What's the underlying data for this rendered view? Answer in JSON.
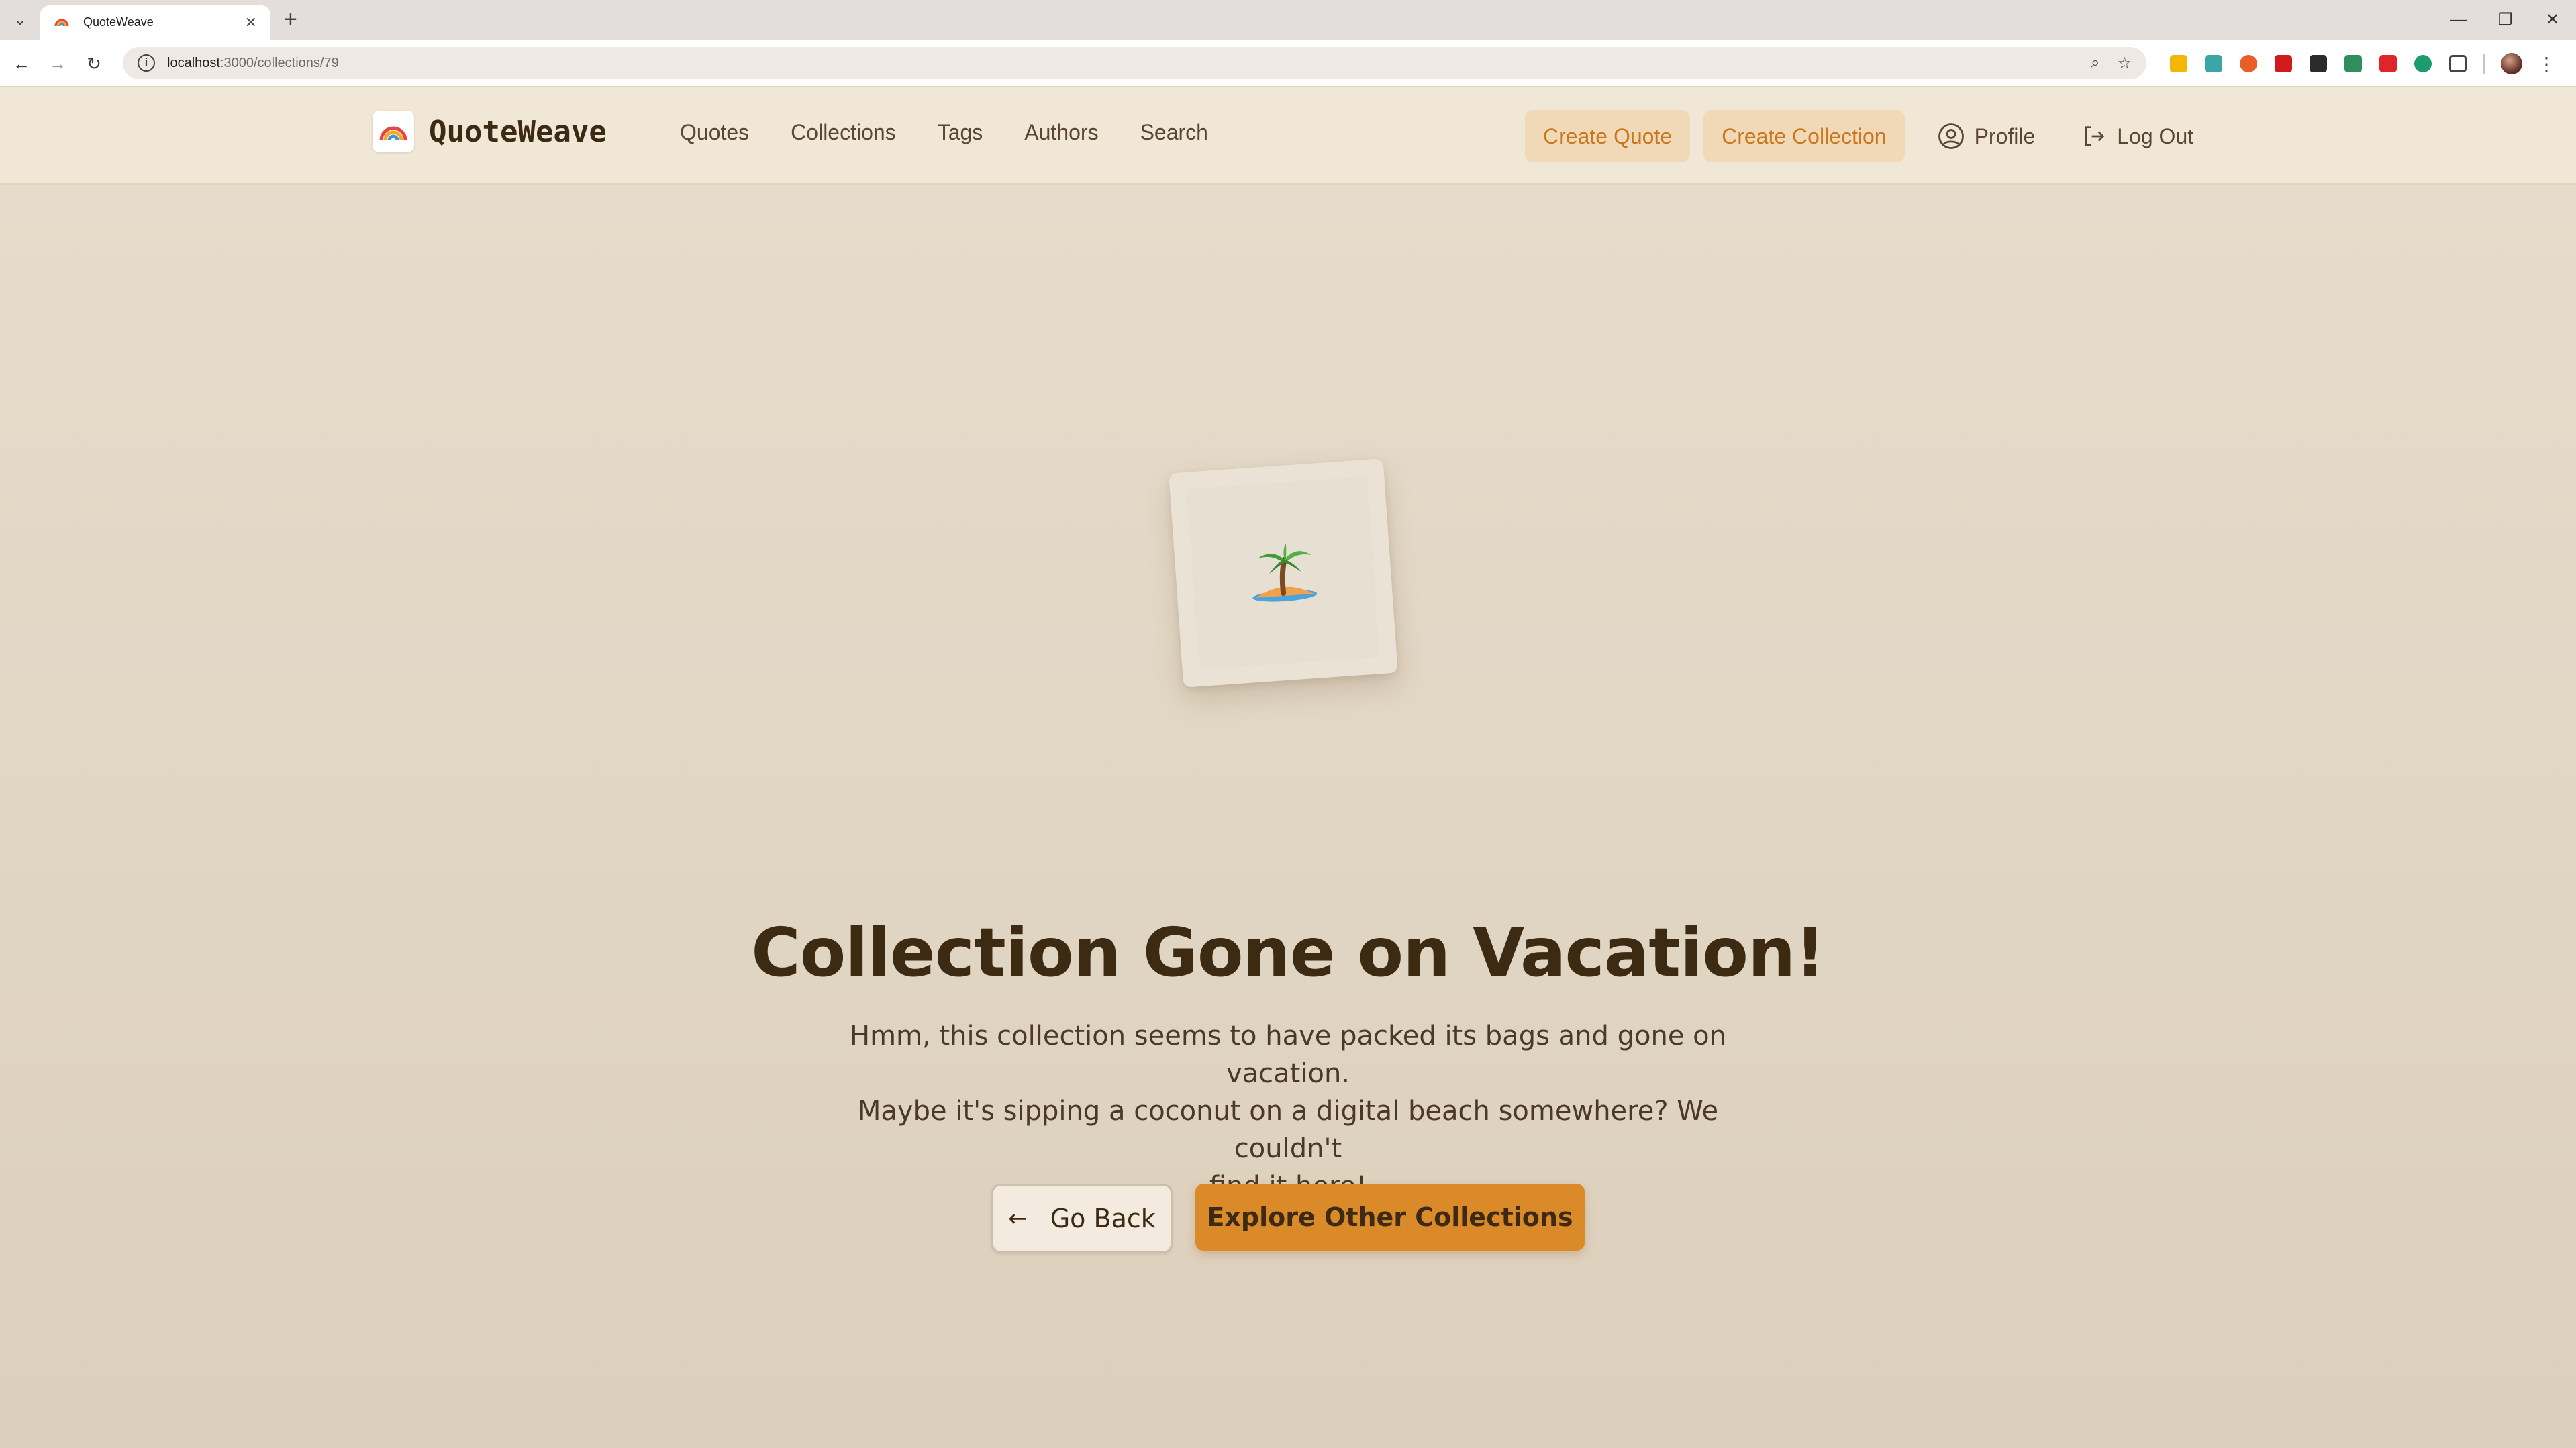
{
  "browser": {
    "tab_title": "QuoteWeave",
    "url_host": "localhost",
    "url_path": ":3000/collections/79"
  },
  "header": {
    "brand": "QuoteWeave",
    "nav": [
      "Quotes",
      "Collections",
      "Tags",
      "Authors",
      "Search"
    ],
    "create_quote": "Create Quote",
    "create_collection": "Create Collection",
    "profile": "Profile",
    "logout": "Log Out"
  },
  "main": {
    "illustration": "palm-tree-island-icon",
    "title": "Collection Gone on Vacation!",
    "message_lines": [
      "Hmm, this collection seems to have packed its bags and gone on vacation.",
      "Maybe it's sipping a coconut on a digital beach somewhere? We couldn't",
      "find it here!"
    ],
    "back_button": "Go Back",
    "explore_button": "Explore Other Collections"
  },
  "colors": {
    "accent": "#db8a2a",
    "header_bg": "#f1e7d6",
    "page_bg": "#e6dccb",
    "text_dark": "#3d2a12"
  }
}
